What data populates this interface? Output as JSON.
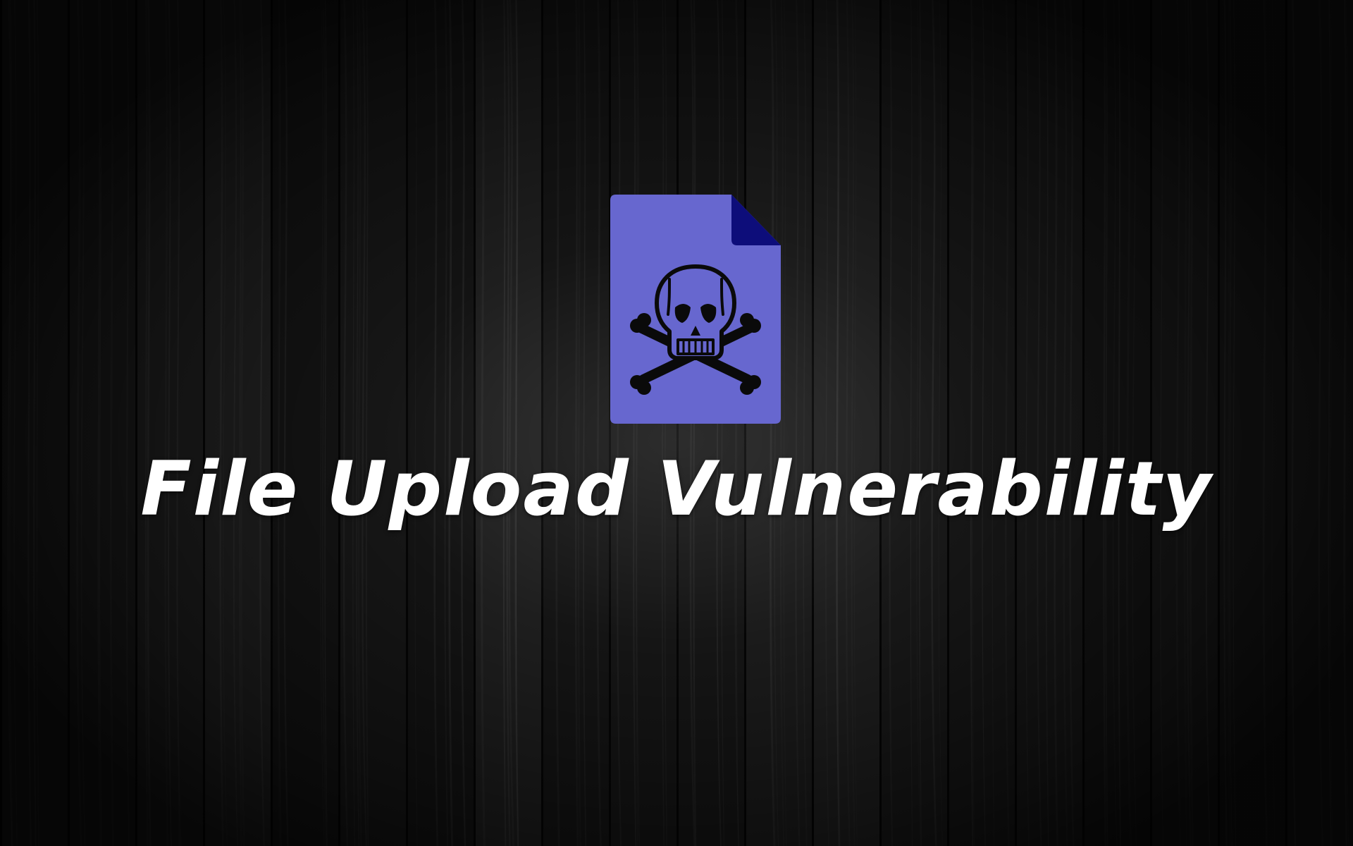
{
  "title": "File Upload Vulnerability",
  "icon": {
    "name": "malicious-file-skull-icon",
    "file_color": "#6767cf",
    "fold_color": "#0d0d7a",
    "skull_color": "#0a0a0a"
  },
  "background": {
    "style": "dark wood planks",
    "base_color": "#141414"
  }
}
